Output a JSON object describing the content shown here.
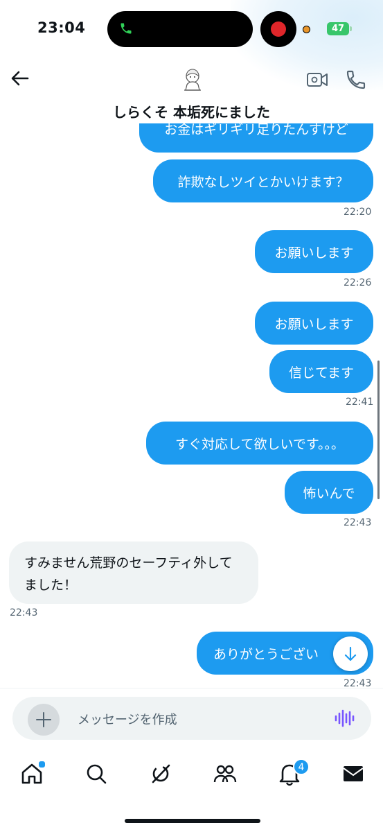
{
  "status_bar": {
    "time": "23:04",
    "battery": "47"
  },
  "header": {
    "title": "しらくそ 本垢死にました"
  },
  "messages": {
    "m0": {
      "text": "お金はギリギリ足りたんすけど"
    },
    "m1": {
      "text": "詐欺なしツイとかいけます？"
    },
    "t1": "22:20",
    "m2": {
      "text": "お願いします"
    },
    "t2": "22:26",
    "m3": {
      "text": "お願いします"
    },
    "m4": {
      "text": "信じてます"
    },
    "t4": "22:41",
    "m5": {
      "text": "すぐ対応して欲しいです。。。"
    },
    "m6": {
      "text": "怖いんで"
    },
    "t6": "22:43",
    "m7": {
      "text": "すみません荒野のセーフティ外してました！"
    },
    "t7": "22:43",
    "m8": {
      "text": "ありがとうござい"
    },
    "t8": "22:43"
  },
  "composer": {
    "placeholder": "メッセージを作成"
  },
  "nav": {
    "notifications_badge": "4"
  },
  "colors": {
    "accent": "#1d9bf0",
    "incoming": "#eff3f4",
    "text": "#0f1419",
    "muted": "#536471"
  }
}
